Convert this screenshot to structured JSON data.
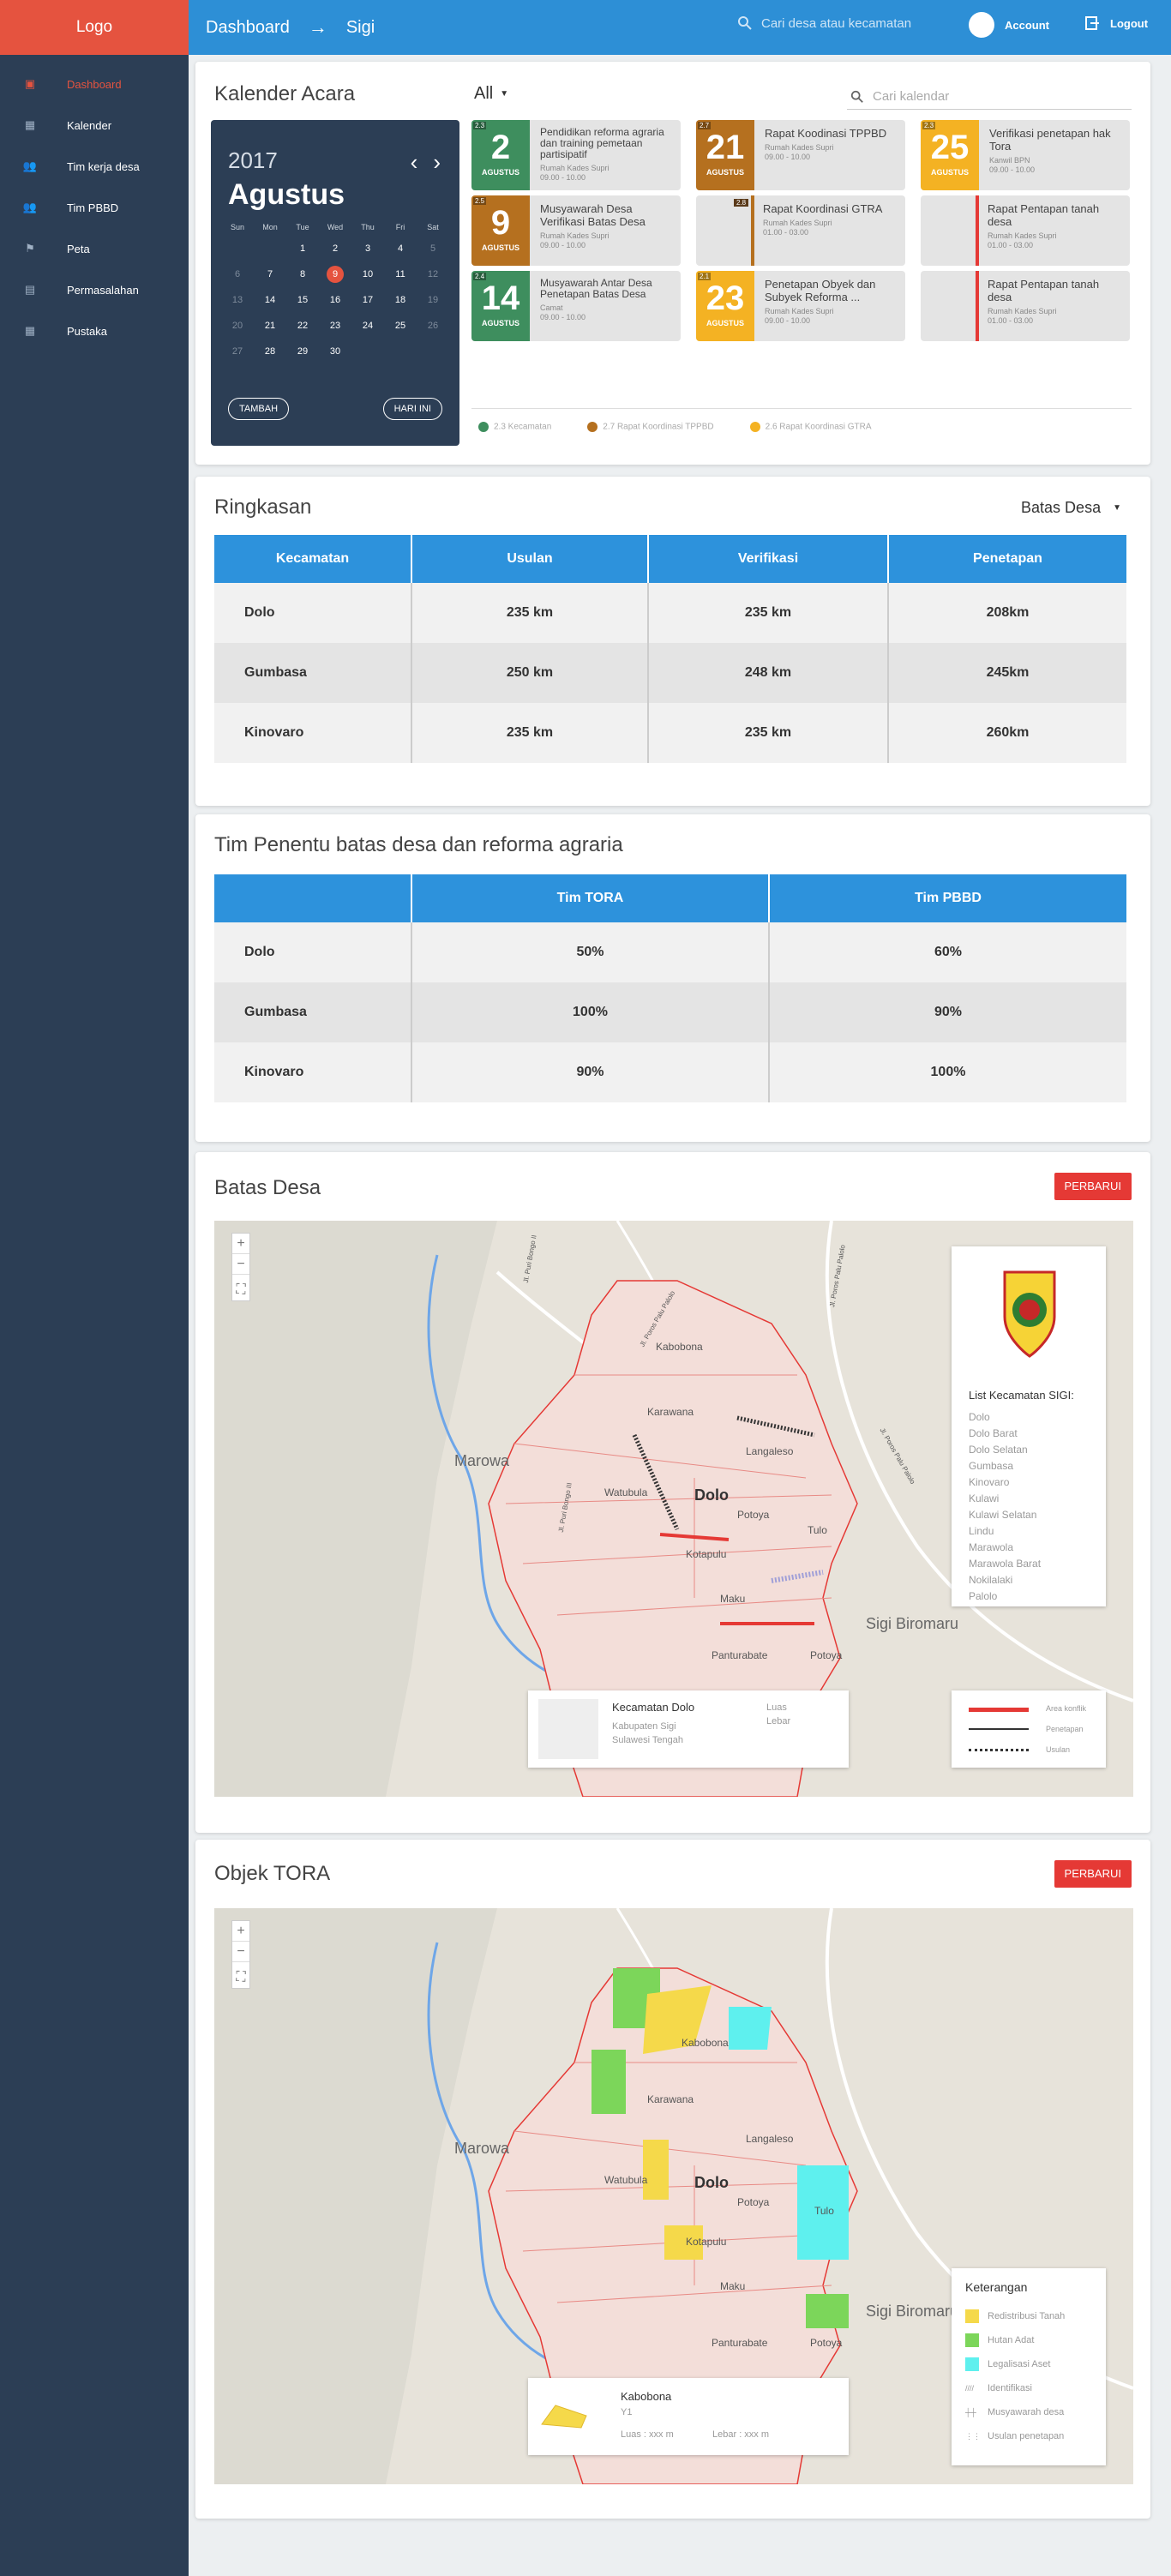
{
  "header": {
    "logo": "Logo",
    "crumb1": "Dashboard",
    "crumb2": "Sigi",
    "search_placeholder": "Cari desa atau kecamatan",
    "account": "Account",
    "logout": "Logout"
  },
  "sidebar": {
    "items": [
      {
        "label": "Dashboard",
        "icon": "dashboard-icon",
        "active": true
      },
      {
        "label": "Kalender",
        "icon": "calendar-icon"
      },
      {
        "label": "Tim kerja desa",
        "icon": "people-icon"
      },
      {
        "label": "Tim PBBD",
        "icon": "people-icon"
      },
      {
        "label": "Peta",
        "icon": "flag-icon"
      },
      {
        "label": "Permasalahan",
        "icon": "inbox-icon"
      },
      {
        "label": "Pustaka",
        "icon": "calendar-icon"
      }
    ]
  },
  "calendar": {
    "title": "Kalender Acara",
    "year": "2017",
    "month": "Agustus",
    "dow": [
      "Sun",
      "Mon",
      "Tue",
      "Wed",
      "Thu",
      "Fri",
      "Sat"
    ],
    "days": [
      "",
      "",
      "1",
      "2",
      "3",
      "4",
      "5",
      "6",
      "7",
      "8",
      "9",
      "10",
      "11",
      "12",
      "13",
      "14",
      "15",
      "16",
      "17",
      "18",
      "19",
      "20",
      "21",
      "22",
      "23",
      "24",
      "25",
      "26",
      "27",
      "28",
      "29",
      "30"
    ],
    "today": "9",
    "add_label": "TAMBAH",
    "today_label": "HARI INI",
    "filter": "All",
    "search_placeholder": "Cari kalendar",
    "events": [
      {
        "tag": "2.3",
        "num": "2",
        "mon": "AGUSTUS",
        "color": "#3e8e5e",
        "title": "Pendidikan reforma agraria dan training pemetaan partisipatif",
        "loc": "Rumah Kades Supri",
        "time": "09.00 - 10.00"
      },
      {
        "tag": "2.7",
        "num": "21",
        "mon": "AGUSTUS",
        "color": "#b5701f",
        "title": "Rapat Koodinasi TPPBD",
        "loc": "Rumah Kades Supri",
        "time": "09.00 - 10.00"
      },
      {
        "tag": "2.3",
        "num": "25",
        "mon": "AGUSTUS",
        "color": "#f4b223",
        "title": "Verifikasi penetapan hak Tora",
        "loc": "Kanwil BPN",
        "time": "09.00 - 10.00"
      },
      {
        "tag": "2.5",
        "num": "9",
        "mon": "AGUSTUS",
        "color": "#b5701f",
        "title": "Musyawarah Desa Verifikasi Batas Desa",
        "loc": "Rumah Kades Supri",
        "time": "09.00 - 10.00"
      },
      {
        "tag": "2.8",
        "title": "Rapat Koordinasi GTRA",
        "loc": "Rumah Kades Supri",
        "time": "01.00 - 03.00",
        "color": "#b5701f"
      },
      {
        "title": "Rapat Pentapan tanah desa",
        "loc": "Rumah Kades Supri",
        "time": "01.00 - 03.00",
        "color": "#e53935"
      },
      {
        "tag": "2.4",
        "num": "14",
        "mon": "AGUSTUS",
        "color": "#3e8e5e",
        "title": "Musyawarah Antar Desa Penetapan Batas Desa",
        "loc": "Camat",
        "time": "09.00 - 10.00"
      },
      {
        "tag": "2.1",
        "num": "23",
        "mon": "AGUSTUS",
        "color": "#f4b223",
        "title": "Penetapan Obyek dan Subyek Reforma ...",
        "loc": "Rumah Kades Supri",
        "time": "09.00 - 10.00"
      },
      {
        "title": "Rapat Pentapan tanah desa",
        "loc": "Rumah Kades Supri",
        "time": "01.00 - 03.00",
        "color": "#e53935"
      }
    ],
    "legend": [
      {
        "label": "2.3 Kecamatan",
        "color": "#3e8e5e"
      },
      {
        "label": "2.7 Rapat Koordinasi TPPBD",
        "color": "#b5701f"
      },
      {
        "label": "2.6 Rapat Koordinasi GTRA",
        "color": "#f4b223"
      }
    ]
  },
  "ringkasan": {
    "title": "Ringkasan",
    "filter": "Batas Desa",
    "headers": [
      "Kecamatan",
      "Usulan",
      "Verifikasi",
      "Penetapan"
    ],
    "rows": [
      [
        "Dolo",
        "235 km",
        "235 km",
        "208km"
      ],
      [
        "Gumbasa",
        "250 km",
        "248 km",
        "245km"
      ],
      [
        "Kinovaro",
        "235 km",
        "235 km",
        "260km"
      ]
    ]
  },
  "tim": {
    "title": "Tim Penentu batas desa dan reforma agraria",
    "headers": [
      "",
      "Tim TORA",
      "Tim PBBD"
    ],
    "rows": [
      [
        "Dolo",
        "50%",
        "60%"
      ],
      [
        "Gumbasa",
        "100%",
        "90%"
      ],
      [
        "Kinovaro",
        "90%",
        "100%"
      ]
    ]
  },
  "batas": {
    "title": "Batas Desa",
    "button": "PERBARUI",
    "map_labels": {
      "marowa": "Marowa",
      "dolo": "Dolo",
      "sigi": "Sigi Biromaru",
      "kabobona": "Kabobona",
      "karawana": "Karawana",
      "langaleso": "Langaleso",
      "watubula": "Watubula",
      "potoya": "Potoya",
      "tulo": "Tulo",
      "kotapulu": "Kotapulu",
      "maku": "Maku",
      "panturabate": "Panturabate",
      "potoya2": "Potoya",
      "road1": "Jl. Poros Palu Palolo",
      "road2": "Jl. Poros Palu Palolo",
      "road3": "Jl. Puri Bongo II",
      "road4": "Jl. Puri Bongo III",
      "road5": "Jl. Poros Palu Palolo"
    },
    "list_title": "List Kecamatan SIGI:",
    "list": [
      "Dolo",
      "Dolo Barat",
      "Dolo Selatan",
      "Gumbasa",
      "Kinovaro",
      "Kulawi",
      "Kulawi Selatan",
      "Lindu",
      "Marawola",
      "Marawola Barat",
      "Nokilalaki",
      "Palolo"
    ],
    "info": {
      "title": "Kecamatan Dolo",
      "line1": "Kabupaten Sigi",
      "line2": "Sulawesi Tengah",
      "luas": "Luas",
      "lebar": "Lebar"
    },
    "legend": [
      {
        "label": "Area konflik"
      },
      {
        "label": "Penetapan"
      },
      {
        "label": "Usulan"
      }
    ]
  },
  "tora": {
    "title": "Objek TORA",
    "button": "PERBARUI",
    "info": {
      "title": "Kabobona",
      "sub": "Y1",
      "luas": "Luas : xxx m",
      "lebar": "Lebar : xxx m"
    },
    "legend_title": "Keterangan",
    "legend": [
      {
        "label": "Redistribusi Tanah",
        "color": "#f5d94a"
      },
      {
        "label": "Hutan Adat",
        "color": "#7cd65a"
      },
      {
        "label": "Legalisasi Aset",
        "color": "#5ef0ee"
      },
      {
        "label": "Identifikasi"
      },
      {
        "label": "Musyawarah desa"
      },
      {
        "label": "Usulan penetapan"
      }
    ]
  }
}
